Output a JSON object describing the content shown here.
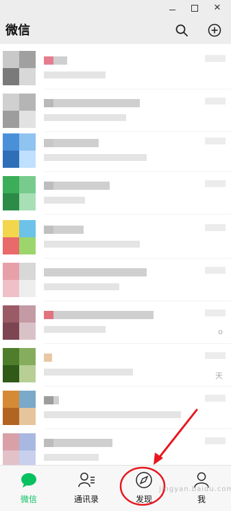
{
  "window": {
    "minimize_label": "–",
    "close_label": "✕"
  },
  "header": {
    "title": "微信",
    "search_icon": "search-icon",
    "add_icon": "plus-circle-icon"
  },
  "chats": [
    {
      "avatar": [
        "#c9c9c9",
        "#a0a0a0",
        "#7a7a7a",
        "#d8d8d8"
      ],
      "accent": "#e57d8e",
      "tail": ""
    },
    {
      "avatar": [
        "#d0d0d0",
        "#b5b5b5",
        "#9d9d9d",
        "#e2e2e2"
      ],
      "accent": "#b9b9b9",
      "tail": ""
    },
    {
      "avatar": [
        "#4a90d9",
        "#8fc3f0",
        "#2f6fb8",
        "#bfe0ff"
      ],
      "accent": "#c8c8c8",
      "tail": ""
    },
    {
      "avatar": [
        "#3cae5a",
        "#77cc8d",
        "#2c8c47",
        "#a8dfb5"
      ],
      "accent": "#bdbdbd",
      "tail": ""
    },
    {
      "avatar": [
        "#f2d64b",
        "#6cc2e8",
        "#e86a6a",
        "#9bd56b"
      ],
      "accent": "#c0c0c0",
      "tail": ""
    },
    {
      "avatar": [
        "#e8a0a8",
        "#d8d8d8",
        "#f0c0c8",
        "#eeeeee"
      ],
      "accent": "#cfcfcf",
      "tail": ""
    },
    {
      "avatar": [
        "#9a5a66",
        "#c49aa4",
        "#7d4451",
        "#d9c2c7"
      ],
      "accent": "#e2737e",
      "tail": "o"
    },
    {
      "avatar": [
        "#4e7d2c",
        "#86ad5d",
        "#2f5a17",
        "#b7cf95"
      ],
      "accent": "#e8c9a4",
      "tail": "天"
    },
    {
      "avatar": [
        "#d58a36",
        "#7aa9c9",
        "#b26522",
        "#e6c49c"
      ],
      "accent": "#9d9d9d",
      "tail": ""
    },
    {
      "avatar": [
        "#d9a0a8",
        "#a8b8e0",
        "#e2c2c8",
        "#c8d0ee"
      ],
      "accent": "#bcbcbc",
      "tail": ""
    }
  ],
  "nav": {
    "items": [
      {
        "label": "微信",
        "icon": "chat-bubble-icon",
        "active": true
      },
      {
        "label": "通讯录",
        "icon": "contacts-icon",
        "active": false
      },
      {
        "label": "发现",
        "icon": "compass-icon",
        "active": false
      },
      {
        "label": "我",
        "icon": "profile-icon",
        "active": false
      }
    ]
  },
  "colors": {
    "active": "#07c160",
    "annotation": "#e8161e",
    "background": "#ededed"
  },
  "watermark": "jingyan.baidu.com"
}
